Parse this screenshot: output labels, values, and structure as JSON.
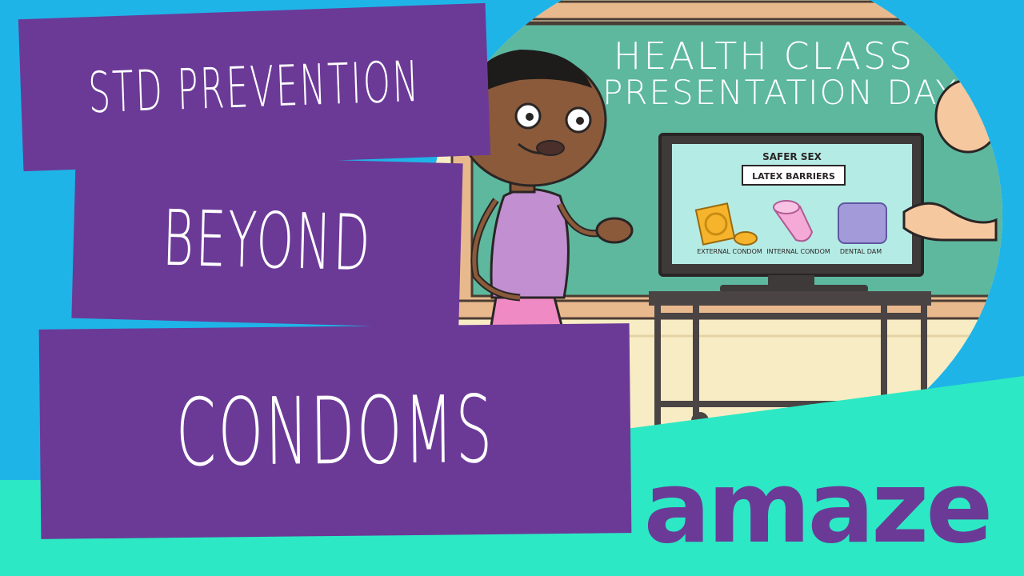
{
  "title_lines": [
    "STD PREVENTION",
    "BEYOND",
    "CONDOMS"
  ],
  "chalkboard": {
    "line1": "HEALTH CLASS",
    "line2": "PRESENTATION DAY"
  },
  "screen": {
    "heading": "SAFER SEX",
    "subheading": "LATEX BARRIERS",
    "items": [
      "EXTERNAL CONDOM",
      "INTERNAL CONDOM",
      "DENTAL DAM"
    ]
  },
  "brand": "amaze",
  "colors": {
    "background": "#1fb4e8",
    "banner": "#6b3a97",
    "accent": "#2de8c4",
    "chalkboard": "#5db89e"
  }
}
